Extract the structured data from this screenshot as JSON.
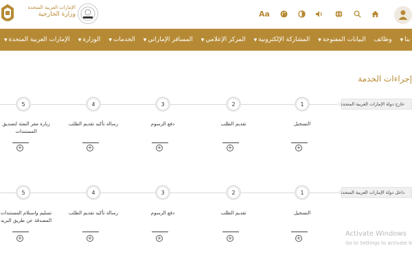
{
  "header": {
    "ministry_name_line1": "الإمارات العربية المتحدة",
    "ministry_name_line2": "وزارة الخارجية",
    "font_size_label": "Aa",
    "icons": [
      "palette-icon",
      "contrast-icon",
      "volume-icon",
      "globe-icon",
      "search-icon",
      "home-icon"
    ]
  },
  "nav": {
    "items": [
      {
        "label": "الإمارات العربية المتحدة",
        "has_menu": true
      },
      {
        "label": "الوزارة",
        "has_menu": true
      },
      {
        "label": "الخدمات",
        "has_menu": true
      },
      {
        "label": "المسافر الإماراتي",
        "has_menu": true
      },
      {
        "label": "المركز الإعلامي",
        "has_menu": true
      },
      {
        "label": "المشاركة الإلكترونية",
        "has_menu": true
      },
      {
        "label": "البيانات المفتوحة",
        "has_menu": true
      },
      {
        "label": "وظائف",
        "has_menu": false
      },
      {
        "label": "اتصل بنا",
        "has_menu": true
      }
    ]
  },
  "page_title": "إجراءات الخدمة",
  "processes": [
    {
      "label": "خارج دولة الإمارات العربية المتحدة",
      "steps": [
        {
          "number": "1",
          "label": "التسجيل"
        },
        {
          "number": "2",
          "label": "تقديم الطلب"
        },
        {
          "number": "3",
          "label": "دفع الرسوم"
        },
        {
          "number": "4",
          "label": "رسالة تأكيد تقديم الطلب"
        },
        {
          "number": "5",
          "label": "زيارة مقر البعثة لتصديق المستندات"
        }
      ]
    },
    {
      "label": "داخل دولة الإمارات العربية المتحدة",
      "steps": [
        {
          "number": "1",
          "label": "التسجيل"
        },
        {
          "number": "2",
          "label": "تقديم الطلب"
        },
        {
          "number": "3",
          "label": "دفع الرسوم"
        },
        {
          "number": "4",
          "label": "رسالة تأكيد تقديم الطلب"
        },
        {
          "number": "5",
          "label": "تسليم واستلام المستندات المصدقة عن طريق البريد"
        }
      ]
    }
  ],
  "watermark": {
    "title": "Activate Windows",
    "subtitle": "Go to Settings to activate Windows."
  },
  "colors": {
    "accent": "#b68a35"
  }
}
